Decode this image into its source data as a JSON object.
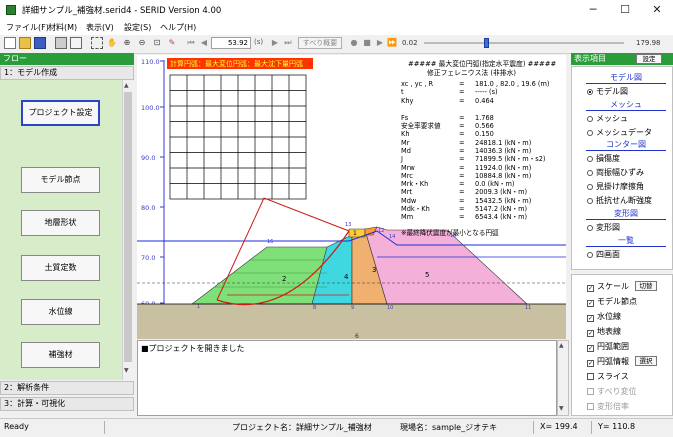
{
  "window": {
    "title": "詳細サンプル_補強材.serid4 - SERID Version 4.00",
    "minimize": "─",
    "maximize": "☐",
    "close": "✕"
  },
  "menu": [
    "ファイル(F)",
    "材料(M)",
    "表示(V)",
    "設定(S)",
    "ヘルプ(H)"
  ],
  "toolbar": {
    "time_value": "53.92",
    "time_unit": "(s)",
    "slip_button": "すべり概要",
    "speed_min": "0.02",
    "speed_max": "179.98",
    "speed_level": 0.3
  },
  "left_panel": {
    "header": "フロー",
    "section_model": "1：モデル作成",
    "buttons": [
      "プロジェクト設定",
      "モデル節点",
      "地層形状",
      "土質定数",
      "水位線",
      "補強材"
    ],
    "section_analysis": "2：解析条件",
    "section_calc": "3：計算・可視化"
  },
  "canvas": {
    "y_ticks": [
      "110.0",
      "100.0",
      "90.0",
      "80.0",
      "70.0",
      "60.0"
    ],
    "banner": "計算円弧：最大変位円弧：最大沈下量円弧",
    "result_title": "##### 最大変位円弧(指定水平震度) #####",
    "result_subtitle": "修正フェレニウス法 (非排水)",
    "result_rows": [
      [
        "xc , yc , R",
        "=",
        "181.0 , 82.0 , 19.6 (m)"
      ],
      [
        "t",
        "=",
        "----- (s)"
      ],
      [
        "Khy",
        "=",
        "0.464"
      ],
      [
        "Fs",
        "=",
        "1.768"
      ],
      [
        "安全率要求値",
        "=",
        "0.566"
      ],
      [
        "Kh",
        "=",
        "0.150"
      ],
      [
        "Mr",
        "=",
        "24818.1 (kN・m)"
      ],
      [
        "Md",
        "=",
        "14036.3 (kN・m)"
      ],
      [
        "J",
        "=",
        "71899.5 (kN・m・s2)"
      ],
      [
        "Mrw",
        "=",
        "11924.0 (kN・m)"
      ],
      [
        "Mrc",
        "=",
        "10884.8 (kN・m)"
      ],
      [
        "Mrk・Kh",
        "=",
        "0.0 (kN・m)"
      ],
      [
        "Mrt",
        "=",
        "2009.3 (kN・m)"
      ],
      [
        "Mdw",
        "=",
        "15432.5 (kN・m)"
      ],
      [
        "Mdk・Kh",
        "=",
        "5147.2 (kN・m)"
      ],
      [
        "Mm",
        "=",
        "6543.4 (kN・m)"
      ]
    ],
    "result_note": "※最終降伏震度が最小となる円弧",
    "layer_labels": [
      "1",
      "2",
      "3",
      "4",
      "5",
      "6",
      "7"
    ],
    "node_labels": [
      "13",
      "12",
      "14",
      "15",
      "1",
      "8",
      "9",
      "10",
      "11",
      "16",
      "7",
      "10",
      "4"
    ]
  },
  "log": {
    "line": "■プロジェクトを開きました"
  },
  "right_panel": {
    "header": "表示項目",
    "settings_button": "設定",
    "groups": {
      "model": "モデル図",
      "mesh": "メッシュ",
      "contour": "コンター図",
      "deform": "変形図",
      "list": "一覧"
    },
    "radios": [
      "モデル図",
      "メッシュ",
      "メッシュデータ",
      "損傷度",
      "両振幅ひずみ",
      "見掛け摩擦角",
      "抵抗せん断強度",
      "変形図",
      "四画面"
    ],
    "checks": [
      {
        "label": "スケール",
        "checked": true,
        "button": "切替"
      },
      {
        "label": "モデル節点",
        "checked": true
      },
      {
        "label": "水位線",
        "checked": true
      },
      {
        "label": "地表線",
        "checked": true
      },
      {
        "label": "円弧範囲",
        "checked": true
      },
      {
        "label": "円弧情報",
        "checked": true,
        "button": "選択"
      },
      {
        "label": "スライス",
        "checked": false
      },
      {
        "label": "すべり変位",
        "checked": false,
        "disabled": true
      },
      {
        "label": "変形倍率",
        "checked": false,
        "disabled": true
      }
    ]
  },
  "status": {
    "ready": "Ready",
    "project": "プロジェクト名：詳細サンプル_補強材",
    "site": "現場名：sample_ジオテキ",
    "x": "X= 199.4",
    "y": "Y= 110.8"
  }
}
